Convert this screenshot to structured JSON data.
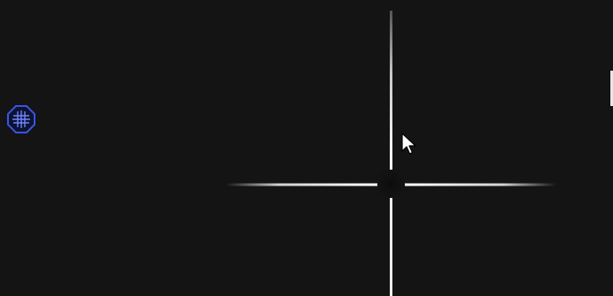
{
  "toolbar": {
    "grid_tool": {
      "icon": "grid-icon",
      "accent": "#3b53e0",
      "fill": "#0d1230"
    }
  },
  "overlay": {
    "crosshair_color": "#e8e8e8",
    "background": "#141414"
  },
  "pointer": {
    "icon": "arrow-cursor-icon"
  }
}
